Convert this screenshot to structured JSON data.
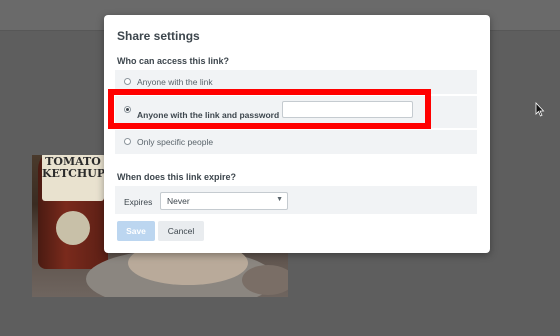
{
  "background": {
    "photo": {
      "bottle_label": "TOMATO KETCHUP"
    }
  },
  "dialog": {
    "title": "Share settings",
    "access": {
      "question": "Who can access this link?",
      "options": [
        {
          "label": "Anyone with the link",
          "selected": false
        },
        {
          "label": "Anyone with the link and password",
          "selected": true
        },
        {
          "label": "Only specific people",
          "selected": false
        }
      ],
      "password_value": "",
      "password_placeholder": ""
    },
    "expire": {
      "question": "When does this link expire?",
      "label": "Expires",
      "selected": "Never"
    },
    "buttons": {
      "save": "Save",
      "cancel": "Cancel"
    }
  },
  "colors": {
    "highlight": "#ff0000",
    "save_button": "#bcd6f0",
    "overlay": "#5e5e5e"
  }
}
